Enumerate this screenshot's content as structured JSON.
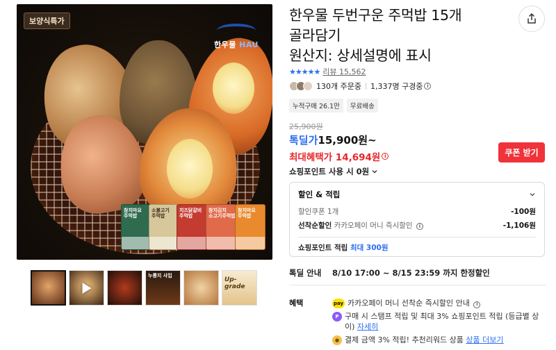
{
  "image": {
    "badge": "보양식특가",
    "brand_logo_text": "한우물",
    "brand_logo_sub": "HAU",
    "packs": [
      {
        "label": "참치마요 주먹밥",
        "color": "#2f6b4f"
      },
      {
        "label": "소불고기 주먹밥",
        "color": "#d8c79a"
      },
      {
        "label": "치즈닭갈비 주먹밥",
        "color": "#c43b2f"
      },
      {
        "label": "참치김치 소고기주먹밥",
        "color": "#e06a4a"
      },
      {
        "label": "참치마요 주먹밥",
        "color": "#e98a2e"
      }
    ]
  },
  "thumbnails": [
    {
      "label": "",
      "type": "image",
      "active": true
    },
    {
      "label": "",
      "type": "video",
      "active": false
    },
    {
      "label": "",
      "type": "image",
      "active": false
    },
    {
      "label": "누룽지 사입",
      "type": "image",
      "active": false
    },
    {
      "label": "",
      "type": "image",
      "active": false
    },
    {
      "label": "Up-grade",
      "type": "image",
      "active": false
    }
  ],
  "product": {
    "title_line1": "한우물 두번구운 주먹밥 15개",
    "title_line2": "골라담기",
    "title_line3": "원산지: 상세설명에 표시",
    "stars": "★★★★★",
    "review_label": "리뷰 15,562",
    "order_count": "130개 주문중",
    "follower_count": "1,337명 구경중",
    "tags": [
      "누적구매 26.1만",
      "무료배송"
    ],
    "original_price": "25,900원",
    "sale_label": "톡딜가",
    "sale_price": "15,900원~",
    "best_benefit": "최대혜택가 14,694원",
    "coupon_button": "쿠폰 받기",
    "shopping_point": "쇼핑포인트 사용 시 0원"
  },
  "benefit_box": {
    "title": "할인 & 적립",
    "coupon_label": "할인쿠폰 1개",
    "coupon_amount": "-100원",
    "first_label": "선착순할인",
    "first_sub": "카카오페이 머니 즉시할인",
    "first_amount": "-1,106원",
    "point_label": "쇼핑포인트 적립",
    "point_value": "최대 300원"
  },
  "deal": {
    "label": "톡딜 안내",
    "value": "8/10 17:00 ~ 8/15 23:59 까지 한정할인"
  },
  "perks": {
    "label": "혜택",
    "items": [
      {
        "icon": "pay",
        "text": "카카오페이 머니 선착순 즉시할인 안내"
      },
      {
        "icon": "P",
        "text": "구매 시 스탬프 적립 및 최대 3% 쇼핑포인트 적립 (등급별 상이)",
        "link": "자세히"
      },
      {
        "icon": "coin",
        "text": "결제 금액 3% 적립! 추천리워드 상품",
        "link": "상품 더보기"
      }
    ]
  },
  "colors": {
    "accent_blue": "#2b6ef0",
    "accent_red": "#e8262b",
    "coupon_red": "#f0323a"
  }
}
